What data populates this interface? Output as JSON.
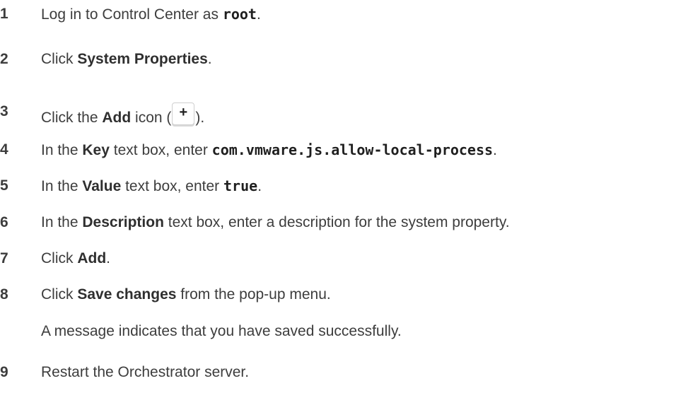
{
  "steps": [
    {
      "num": "1",
      "parts": [
        "Log in to Control Center as ",
        "root",
        "."
      ]
    },
    {
      "num": "2",
      "parts": [
        "Click ",
        "System Properties",
        "."
      ]
    },
    {
      "num": "3",
      "parts": [
        "Click the ",
        "Add",
        " icon (",
        "+",
        ")."
      ],
      "icon": "plus-icon"
    },
    {
      "num": "4",
      "parts": [
        "In the ",
        "Key",
        " text box, enter ",
        "com.vmware.js.allow-local-process",
        "."
      ]
    },
    {
      "num": "5",
      "parts": [
        "In the ",
        "Value",
        " text box, enter ",
        "true",
        "."
      ]
    },
    {
      "num": "6",
      "parts": [
        "In the ",
        "Description",
        " text box, enter a description for the system property."
      ]
    },
    {
      "num": "7",
      "parts": [
        "Click ",
        "Add",
        "."
      ]
    },
    {
      "num": "8",
      "parts": [
        "Click ",
        "Save changes",
        " from the pop-up menu."
      ]
    },
    {
      "num": "9",
      "parts": [
        "Restart the Orchestrator server."
      ]
    }
  ],
  "step8_result": "A message indicates that you have saved successfully."
}
